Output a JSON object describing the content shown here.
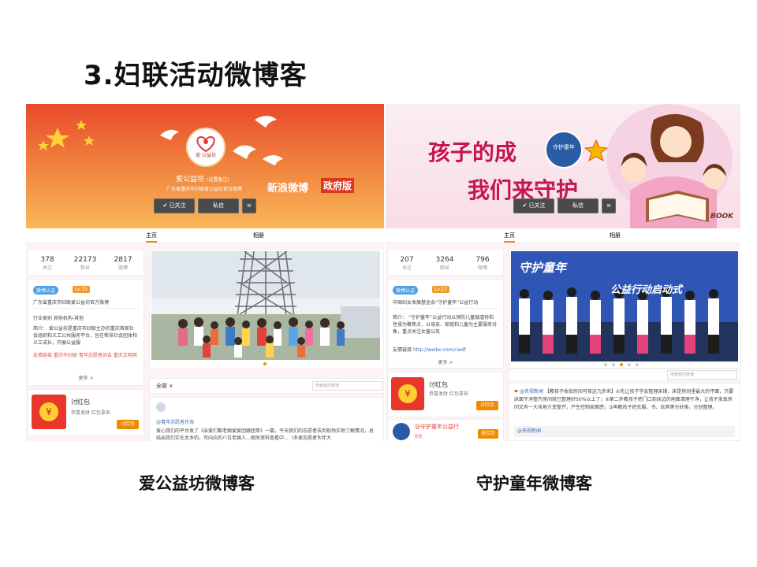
{
  "slide": {
    "title": "3.妇联活动微博客",
    "caption_left": "爱公益坊微博客",
    "caption_right": "守护童年微博客"
  },
  "left": {
    "logo_text": "爱·公益坊",
    "profile_name": "爱公益坊",
    "profile_note": "(设置备注)",
    "bio": "广东省重庆市妇联爱公益坊官方微博",
    "banner_slogan": "新浪微博",
    "banner_badge": "政府版",
    "btn_follow": "✔ 已关注",
    "btn_message": "私信",
    "tab_home": "主页",
    "tab_album": "相册",
    "stats": [
      {
        "value": "378",
        "label": "关注"
      },
      {
        "value": "22173",
        "label": "粉丝"
      },
      {
        "value": "2817",
        "label": "微博"
      }
    ],
    "verify": "微博认证",
    "level": "Lv.15",
    "verify_text": "广东省重庆市妇联爱公益坊官方微博",
    "industry": "行业类别  其他机构-其他",
    "intro": "简介：  爱公益坊是重庆市妇联主办的重庆首家社会组织和义工公共服务平台，旨在帮扶社会团体和义工成长，开展公益服",
    "links": "友情链接  重庆市妇联 青年志愿者协会 重庆文明网",
    "more": "更多 >",
    "hongbao_title": "讨红包",
    "hongbao_desc": "恭喜发财 红包拿来",
    "hongbao_btn": "讨红包",
    "filter": "全部 ∨",
    "search_placeholder": "搜索我的微博",
    "post_user": "@青年志愿者托海",
    "post_text": "爱心我们的平台发了《亲爱们都老姨爱爱团跟团哥》一篇，今天我们的志愿者去到现场实地了解情况，总结出我们实在太多的，可向应的八位老姨人…相关资料查看中…（多更志愿者伙伴大"
  },
  "right": {
    "banner_line1": "孩子的成",
    "banner_line1b": "守护童年",
    "banner_line2": "我们来守护",
    "book": "BOOK",
    "btn_follow": "✔ 已关注",
    "btn_message": "私信",
    "tab_home": "主页",
    "tab_album": "相册",
    "stats": [
      {
        "value": "207",
        "label": "关注"
      },
      {
        "value": "3264",
        "label": "粉丝"
      },
      {
        "value": "796",
        "label": "微博"
      }
    ],
    "verify": "微博认证",
    "level": "Lv.17",
    "verify_text": "中国妇女发展基金会“守护童年”公益行动",
    "intro": "简介：  “守护童年”公益行动以预防儿童被虐待和性侵为聚焦点，以母亲、家庭和儿童为主要服务对象，重点关注女童以及",
    "link_label": "友情链接",
    "link_url": "http://weibo.com/cwdf",
    "more": "更多 >",
    "photo_title": "守护童年",
    "photo_subtitle": "公益行动启动式",
    "hongbao_title": "讨红包",
    "hongbao_desc": "恭喜发财 红包拿来",
    "hongbao_btn": "讨红包",
    "card2_title": "@守护童年公益行",
    "card2_sub": "0元",
    "card2_btn": "抢红包",
    "search_placeholder": "搜索我的微博",
    "post_user": "@央视新闻",
    "post_text": "【教孩子收拾房间可按这几步来】①先让孩子学会整理床铺，床是房间里最大的平面，只要床面干净整齐房间就已整理好50%以上了；②第二步教孩子把门口到床边的地面清理干净，让孩子发现房间又有一大块地方变整齐，产生控制局面感；③再教孩子把衣服、书、玩具等分好类，分别整理。",
    "post_reply": "@央视新闻"
  }
}
